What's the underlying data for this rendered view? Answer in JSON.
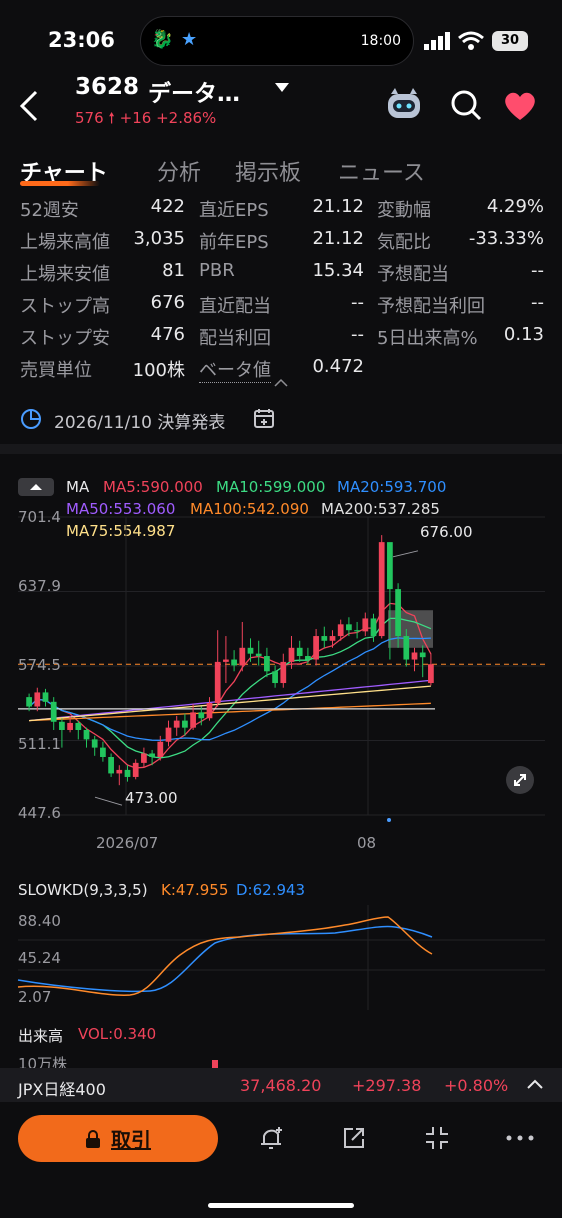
{
  "status_bar": {
    "time": "23:06",
    "island_time": "18:00",
    "battery": "30"
  },
  "header": {
    "code": "3628",
    "name": "データ…",
    "price": "576",
    "change": "+16",
    "change_pct": "+2.86%"
  },
  "tabs": [
    "チャート",
    "分析",
    "掲示板",
    "ニュース"
  ],
  "stats": [
    {
      "label": "52週安",
      "value": "422"
    },
    {
      "label": "直近EPS",
      "value": "21.12"
    },
    {
      "label": "変動幅",
      "value": "4.29%"
    },
    {
      "label": "上場来高値",
      "value": "3,035"
    },
    {
      "label": "前年EPS",
      "value": "21.12"
    },
    {
      "label": "気配比",
      "value": "-33.33%"
    },
    {
      "label": "上場来安値",
      "value": "81"
    },
    {
      "label": "PBR",
      "value": "15.34"
    },
    {
      "label": "予想配当",
      "value": "--"
    },
    {
      "label": "ストップ高",
      "value": "676"
    },
    {
      "label": "直近配当",
      "value": "--"
    },
    {
      "label": "予想配当利回",
      "value": "--"
    },
    {
      "label": "ストップ安",
      "value": "476"
    },
    {
      "label": "配当利回",
      "value": "--"
    },
    {
      "label": "5日出来高%",
      "value": "0.13"
    },
    {
      "label": "売買単位",
      "value": "100株"
    },
    {
      "label": "ベータ値",
      "value": "0.472"
    }
  ],
  "earnings": {
    "text": "2026/11/10 決算発表"
  },
  "ma": {
    "label": "MA",
    "ma5": "MA5:590.000",
    "ma10": "MA10:599.000",
    "ma20": "MA20:593.700",
    "ma50": "MA50:553.060",
    "ma100": "MA100:542.090",
    "ma200": "MA200:537.285",
    "ma75": "MA75:554.987",
    "colors": {
      "ma5": "#f0435a",
      "ma10": "#3ddc84",
      "ma20": "#2f8fff",
      "ma50": "#a05cff",
      "ma100": "#ff8a2a",
      "ma200": "#e0e0e0",
      "ma75": "#ffe08a"
    }
  },
  "chart_axis": {
    "y_labels": [
      "701.4",
      "637.9",
      "574.5",
      "511.1",
      "447.6"
    ],
    "x_labels": [
      "2026/07",
      "08"
    ],
    "high_label": "676.00",
    "low_label": "473.00"
  },
  "chart_data": {
    "type": "candlestick",
    "ylim": [
      447.6,
      701.4
    ],
    "current_price": 576,
    "high": 676.0,
    "low": 473.0,
    "candles": [
      [
        548,
        540,
        551,
        536
      ],
      [
        540,
        552,
        556,
        536
      ],
      [
        552,
        544,
        555,
        540
      ],
      [
        544,
        527,
        548,
        520
      ],
      [
        527,
        520,
        530,
        505
      ],
      [
        520,
        526,
        532,
        518
      ],
      [
        526,
        520,
        528,
        512
      ],
      [
        520,
        512,
        522,
        505
      ],
      [
        512,
        505,
        515,
        498
      ],
      [
        505,
        497,
        510,
        493
      ],
      [
        497,
        483,
        500,
        480
      ],
      [
        483,
        486,
        490,
        473
      ],
      [
        486,
        480,
        490,
        476
      ],
      [
        480,
        492,
        495,
        478
      ],
      [
        492,
        500,
        505,
        488
      ],
      [
        500,
        497,
        503,
        490
      ],
      [
        497,
        510,
        515,
        494
      ],
      [
        510,
        522,
        528,
        506
      ],
      [
        522,
        528,
        532,
        515
      ],
      [
        528,
        522,
        534,
        515
      ],
      [
        522,
        535,
        542,
        520
      ],
      [
        535,
        530,
        540,
        524
      ],
      [
        530,
        543,
        548,
        528
      ],
      [
        543,
        578,
        605,
        540
      ],
      [
        578,
        580,
        600,
        560
      ],
      [
        580,
        575,
        588,
        570
      ],
      [
        575,
        590,
        612,
        570
      ],
      [
        590,
        585,
        598,
        578
      ],
      [
        585,
        583,
        596,
        575
      ],
      [
        583,
        570,
        590,
        565
      ],
      [
        570,
        560,
        575,
        556
      ],
      [
        560,
        578,
        585,
        556
      ],
      [
        578,
        590,
        600,
        572
      ],
      [
        590,
        583,
        596,
        578
      ],
      [
        583,
        580,
        590,
        576
      ],
      [
        580,
        600,
        606,
        575
      ],
      [
        600,
        596,
        608,
        590
      ],
      [
        596,
        600,
        605,
        590
      ],
      [
        600,
        610,
        614,
        596
      ],
      [
        610,
        605,
        616,
        600
      ],
      [
        605,
        604,
        612,
        598
      ],
      [
        604,
        615,
        620,
        600
      ],
      [
        615,
        600,
        619,
        595
      ],
      [
        600,
        680,
        686,
        598
      ],
      [
        680,
        640,
        676,
        580
      ],
      [
        640,
        600,
        645,
        590
      ],
      [
        600,
        580,
        606,
        574
      ],
      [
        580,
        586,
        590,
        570
      ],
      [
        586,
        582,
        592,
        565
      ],
      [
        560,
        576,
        585,
        558
      ]
    ],
    "volume_label": "出来高",
    "volume": "VOL:0.340",
    "volume_unit": "10万株"
  },
  "slowkd": {
    "label": "SLOWKD(9,3,3,5)",
    "k": "K:47.955",
    "d": "D:62.943",
    "y_labels": [
      "88.40",
      "45.24",
      "2.07"
    ]
  },
  "ticker": {
    "name": "JPX日経400",
    "value": "37,468.20",
    "change": "+297.38",
    "change_pct": "+0.80%"
  },
  "actions": {
    "trade_label": "取引"
  }
}
